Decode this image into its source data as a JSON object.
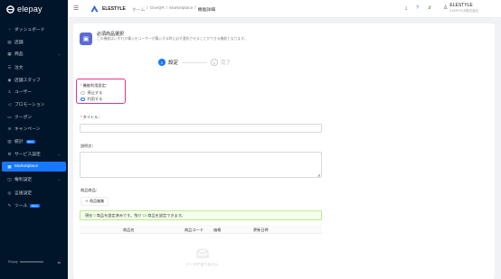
{
  "sidebar": {
    "logo": "elepay",
    "items": [
      {
        "label": "ダッシュボード",
        "icon": "dashboard-icon"
      },
      {
        "label": "店舗",
        "icon": "store-icon"
      },
      {
        "label": "商品",
        "icon": "product-icon"
      },
      {
        "label": "注文",
        "icon": "order-icon"
      },
      {
        "label": "店舗スタッフ",
        "icon": "staff-icon"
      },
      {
        "label": "ユーザー",
        "icon": "user-icon"
      },
      {
        "label": "プロモーション",
        "icon": "promotion-icon"
      },
      {
        "label": "クーポン",
        "icon": "coupon-icon"
      },
      {
        "label": "キャンペーン",
        "icon": "campaign-icon"
      },
      {
        "label": "統計",
        "icon": "stats-icon",
        "tag": "Beta"
      },
      {
        "label": "サービス設定",
        "icon": "service-settings-icon"
      },
      {
        "label": "Marketplace",
        "icon": "marketplace-icon"
      },
      {
        "label": "権利設定",
        "icon": "rights-icon"
      },
      {
        "label": "言語設定",
        "icon": "language-icon"
      },
      {
        "label": "ツール",
        "icon": "tool-icon",
        "tag": "Beta"
      }
    ],
    "footer_label": "Elepay"
  },
  "header": {
    "brand": "ELESTYLE",
    "breadcrumb": [
      "ホーム",
      "OneQR",
      "Marketplace",
      "機能詳細"
    ],
    "user_name": "ELESTYLE",
    "user_sub": "ELESTYLE株式会社"
  },
  "section": {
    "title": "必須商品選択",
    "description": "この機能はいずれか購入をユーザーが購入する時に必ず選択させることができる機能となります。"
  },
  "steps": [
    {
      "num": "1",
      "label": "設定"
    },
    {
      "num": "2",
      "label": "完了"
    }
  ],
  "form": {
    "feature_label": "機能利用設定：",
    "radio_stop": "停止する",
    "radio_use": "利用する",
    "title_label": "タイトル：",
    "desc_label": "説明文：",
    "products_label": "商品商品：",
    "edit_button": "＋ 商品編集",
    "alert_pre": "現在",
    "alert_count": "0",
    "alert_mid": "商品を設定済みです。残り",
    "alert_remain": "10",
    "alert_post": "商品を設定できます。"
  },
  "table": {
    "columns": [
      "商品名",
      "商品コード",
      "価格",
      "更新日時"
    ],
    "empty": "データがありません"
  },
  "colors": {
    "accent": "#1677ff",
    "sidebar": "#001529",
    "highlight": "#e8338a"
  }
}
